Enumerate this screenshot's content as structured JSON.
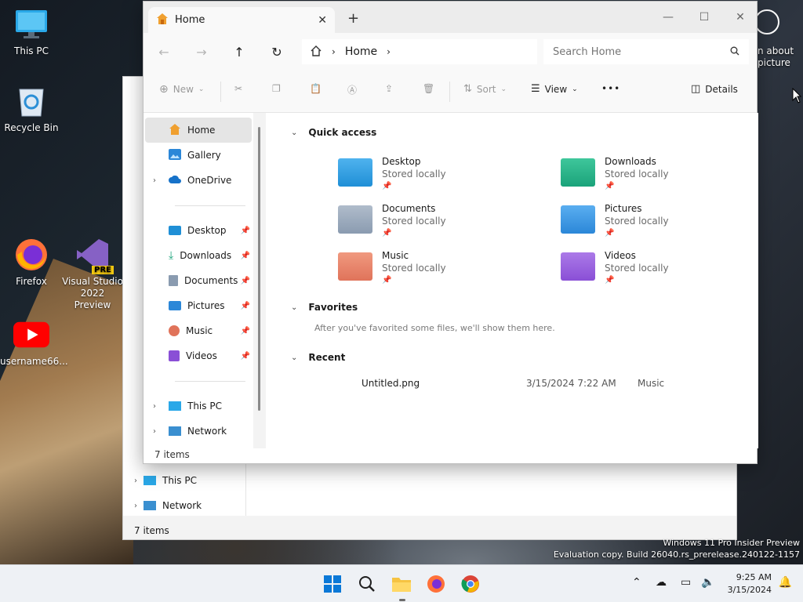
{
  "desktop": {
    "icons": [
      {
        "label": "This PC"
      },
      {
        "label": "Recycle Bin"
      },
      {
        "label": "Firefox"
      },
      {
        "label": "Visual Studio 2022 Preview",
        "badge": "PRE"
      },
      {
        "label": "username66..."
      }
    ],
    "right_partial": {
      "line1": "n about",
      "line2": "picture"
    }
  },
  "back_window": {
    "items": [
      "This PC",
      "Network"
    ],
    "status": "7 items"
  },
  "window": {
    "tab_title": "Home",
    "address": {
      "crumb": "Home"
    },
    "search": {
      "placeholder": "Search Home"
    },
    "toolbar": {
      "new": "New",
      "sort": "Sort",
      "view": "View",
      "more": "•••",
      "details": "Details"
    },
    "nav": {
      "top": [
        "Home",
        "Gallery",
        "OneDrive"
      ],
      "pinned": [
        "Desktop",
        "Downloads",
        "Documents",
        "Pictures",
        "Music",
        "Videos"
      ],
      "bottom": [
        "This PC",
        "Network"
      ],
      "status": "7 items"
    },
    "quick_access": {
      "title": "Quick access",
      "folders": [
        {
          "name": "Desktop",
          "sub": "Stored locally",
          "color": "#1f8fd6"
        },
        {
          "name": "Downloads",
          "sub": "Stored locally",
          "color": "#1aa37a"
        },
        {
          "name": "Documents",
          "sub": "Stored locally",
          "color": "#8a9bb0"
        },
        {
          "name": "Pictures",
          "sub": "Stored locally",
          "color": "#2b87d8"
        },
        {
          "name": "Music",
          "sub": "Stored locally",
          "color": "#e0735a"
        },
        {
          "name": "Videos",
          "sub": "Stored locally",
          "color": "#8a4fd6"
        }
      ]
    },
    "favorites": {
      "title": "Favorites",
      "hint": "After you've favorited some files, we'll show them here."
    },
    "recent": {
      "title": "Recent",
      "rows": [
        {
          "name": "Untitled.png",
          "date": "3/15/2024 7:22 AM",
          "location": "Music"
        }
      ]
    }
  },
  "watermark": {
    "line1": "Windows 11 Pro Insider Preview",
    "line2": "Evaluation copy. Build 26040.rs_prerelease.240122-1157"
  },
  "taskbar": {
    "time": "9:25 AM",
    "date": "3/15/2024"
  }
}
